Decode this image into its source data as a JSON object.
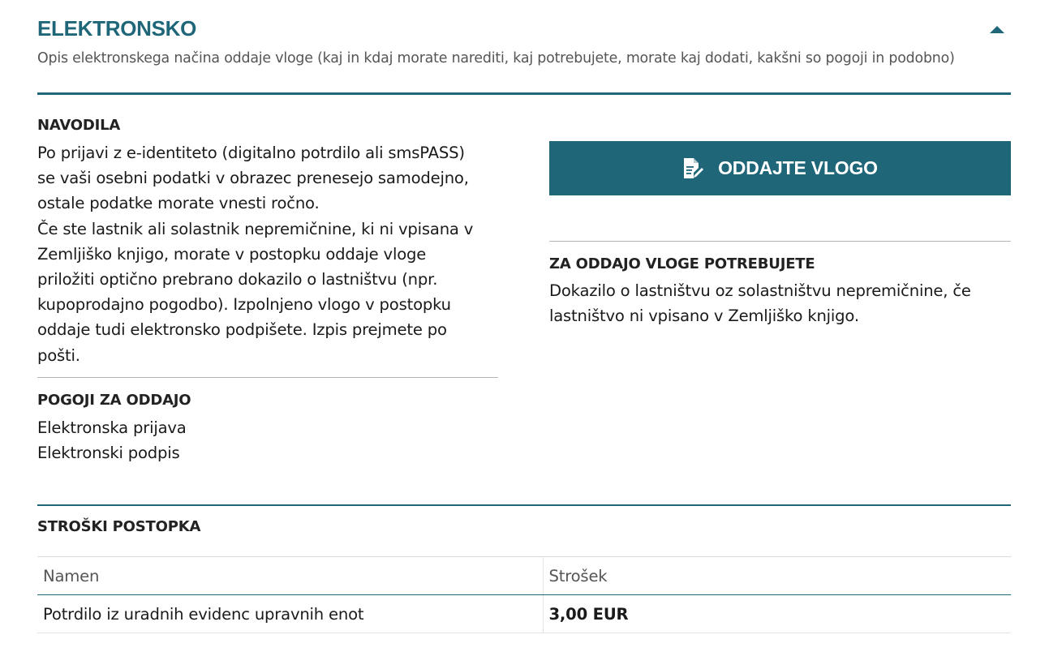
{
  "header": {
    "title": "ELEKTRONSKO",
    "subtitle": "Opis elektronskega načina oddaje vloge (kaj in kdaj morate narediti, kaj potrebujete, morate kaj dodati, kakšni so pogoji in podobno)",
    "collapse_icon": "chevron-up-icon"
  },
  "navodila": {
    "heading": "NAVODILA",
    "lines": [
      "Po prijavi z e-identiteto (digitalno potrdilo ali smsPASS)",
      "se vaši osebni podatki v obrazec prenesejo samodejno,",
      "ostale podatke morate vnesti ročno.",
      "Če ste lastnik ali solastnik nepremičnine, ki ni vpisana v",
      "Zemljiško knjigo, morate v postopku oddaje vloge",
      "priložiti optično prebrano dokazilo o lastništvu (npr.",
      "kupoprodajno pogodbo). Izpolnjeno vlogo v postopku",
      "oddaje tudi elektronsko podpišete. Izpis prejmete po",
      "pošti."
    ]
  },
  "pogoji": {
    "heading": "POGOJI ZA ODDAJO",
    "items": [
      "Elektronska prijava",
      "Elektronski podpis"
    ]
  },
  "submit": {
    "label": "ODDAJTE VLOGO",
    "icon": "document-edit-icon"
  },
  "potrebujete": {
    "heading": "ZA ODDAJO VLOGE POTREBUJETE",
    "lines": [
      "Dokazilo o lastništvu oz solastništvu nepremičnine, če",
      "lastništvo ni vpisano v Zemljiško knjigo."
    ]
  },
  "costs": {
    "heading": "STROŠKI POSTOPKA",
    "columns": [
      "Namen",
      "Strošek"
    ],
    "rows": [
      {
        "namen": "Potrdilo iz uradnih evidenc upravnih enot",
        "strosek": "3,00 EUR"
      }
    ]
  },
  "colors": {
    "accent": "#1f6778",
    "divider": "#b5b5b5",
    "muted_text": "#555555"
  }
}
